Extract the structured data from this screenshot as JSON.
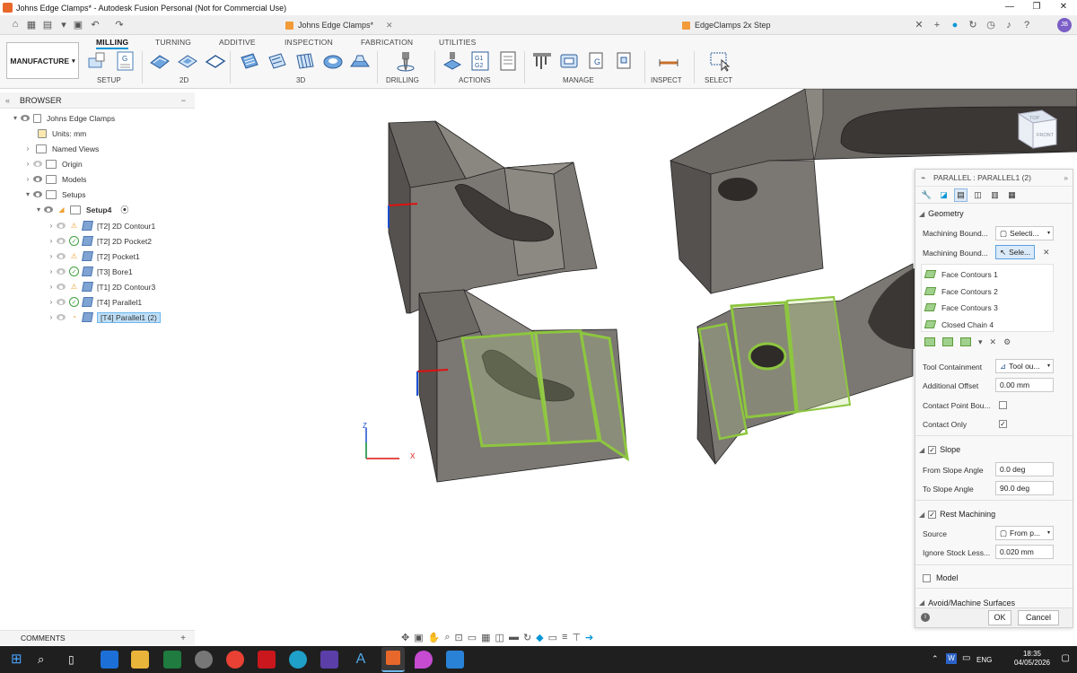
{
  "window": {
    "title": "Johns Edge Clamps* - Autodesk Fusion Personal (Not for Commercial Use)",
    "controls": [
      "—",
      "❐",
      "✕"
    ]
  },
  "tabs": {
    "doc1": "Johns Edge Clamps*",
    "doc2": "EdgeClamps 2x Step",
    "avatar": "JB"
  },
  "ribbon": {
    "workspace": "MANUFACTURE",
    "tabs": [
      "MILLING",
      "TURNING",
      "ADDITIVE",
      "INSPECTION",
      "FABRICATION",
      "UTILITIES"
    ],
    "groups": [
      "SETUP",
      "2D",
      "3D",
      "DRILLING",
      "ACTIONS",
      "MANAGE",
      "INSPECT",
      "SELECT"
    ]
  },
  "browser": {
    "title": "BROWSER",
    "root": "Johns Edge Clamps",
    "units": "Units: mm",
    "named_views": "Named Views",
    "origin": "Origin",
    "models": "Models",
    "setups": "Setups",
    "setup4": "Setup4",
    "ops": [
      {
        "label": "[T2] 2D Contour1",
        "status": "warn"
      },
      {
        "label": "[T2] 2D Pocket2",
        "status": "ok"
      },
      {
        "label": "[T2] Pocket1",
        "status": "warn"
      },
      {
        "label": "[T3] Bore1",
        "status": "ok"
      },
      {
        "label": "[T1] 2D Contour3",
        "status": "warn"
      },
      {
        "label": "[T4] Parallel1",
        "status": "ok"
      },
      {
        "label": "[T4] Parallel1 (2)",
        "status": "pending"
      }
    ]
  },
  "panel": {
    "title": "PARALLEL : PARALLEL1 (2)",
    "geometry": "Geometry",
    "machining_boundary_1": "Machining Bound...",
    "machining_boundary_1_value": "Selecti...",
    "machining_boundary_2": "Machining Bound...",
    "machining_boundary_2_value": "Sele...",
    "list": [
      "Face Contours 1",
      "Face Contours 2",
      "Face Contours 3",
      "Closed Chain 4"
    ],
    "tool_containment": "Tool Containment",
    "tool_containment_value": "Tool ou...",
    "additional_offset": "Additional Offset",
    "additional_offset_value": "0.00 mm",
    "contact_point": "Contact Point Bou...",
    "contact_only": "Contact Only",
    "slope": "Slope",
    "from_slope": "From Slope Angle",
    "from_slope_value": "0.0 deg",
    "to_slope": "To Slope Angle",
    "to_slope_value": "90.0 deg",
    "rest_machining": "Rest Machining",
    "source": "Source",
    "source_value": "From p...",
    "ignore_stock": "Ignore Stock Less...",
    "ignore_stock_value": "0.020 mm",
    "model": "Model",
    "avoid": "Avoid/Machine Surfaces",
    "ok": "OK",
    "cancel": "Cancel"
  },
  "viewcube": {
    "top": "TOP",
    "front": "FRONT"
  },
  "axes": {
    "x": "X",
    "z": "Z"
  },
  "comments": "COMMENTS",
  "taskbar": {
    "lang": "ENG",
    "time": "18:35",
    "date": "04/05/2026"
  },
  "colors": {
    "accent": "#0696d7",
    "selection": "#8dc63f",
    "part": "#6e6a65",
    "taskbar": "#1f1f1f"
  }
}
